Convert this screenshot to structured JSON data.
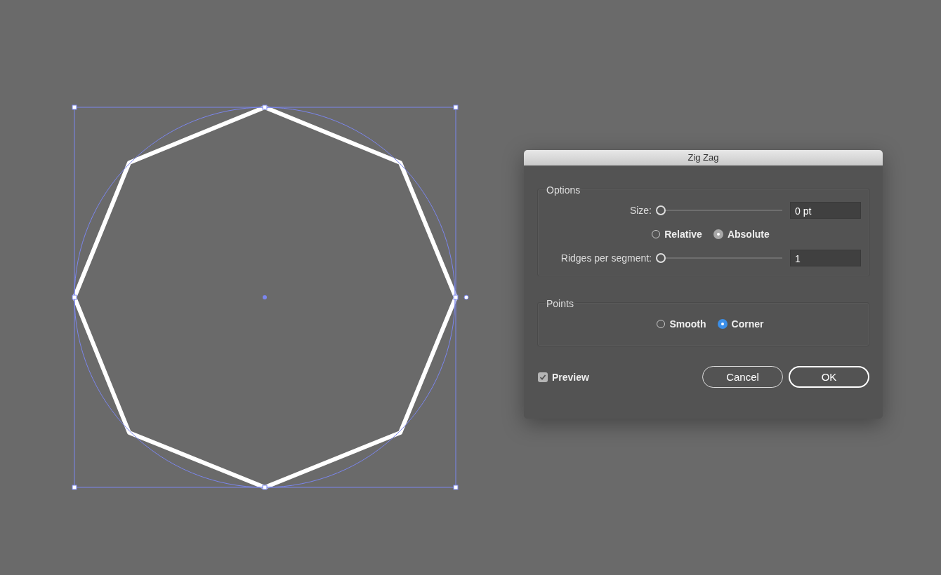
{
  "dialog": {
    "title": "Zig Zag",
    "options": {
      "legend": "Options",
      "size": {
        "label": "Size:",
        "level": 0,
        "value": "0 pt"
      },
      "mode": {
        "disabled": true,
        "choices": [
          {
            "label": "Relative",
            "selected": false
          },
          {
            "label": "Absolute",
            "selected": true
          }
        ]
      },
      "ridges": {
        "label": "Ridges per segment:",
        "level": 0,
        "value": "1"
      }
    },
    "points": {
      "legend": "Points",
      "disabled": false,
      "choices": [
        {
          "label": "Smooth",
          "selected": false
        },
        {
          "label": "Corner",
          "selected": true
        }
      ]
    },
    "preview": {
      "label": "Preview",
      "checked": true
    },
    "buttons": [
      {
        "label": "Cancel",
        "default": false
      },
      {
        "label": "OK",
        "default": true
      }
    ]
  }
}
